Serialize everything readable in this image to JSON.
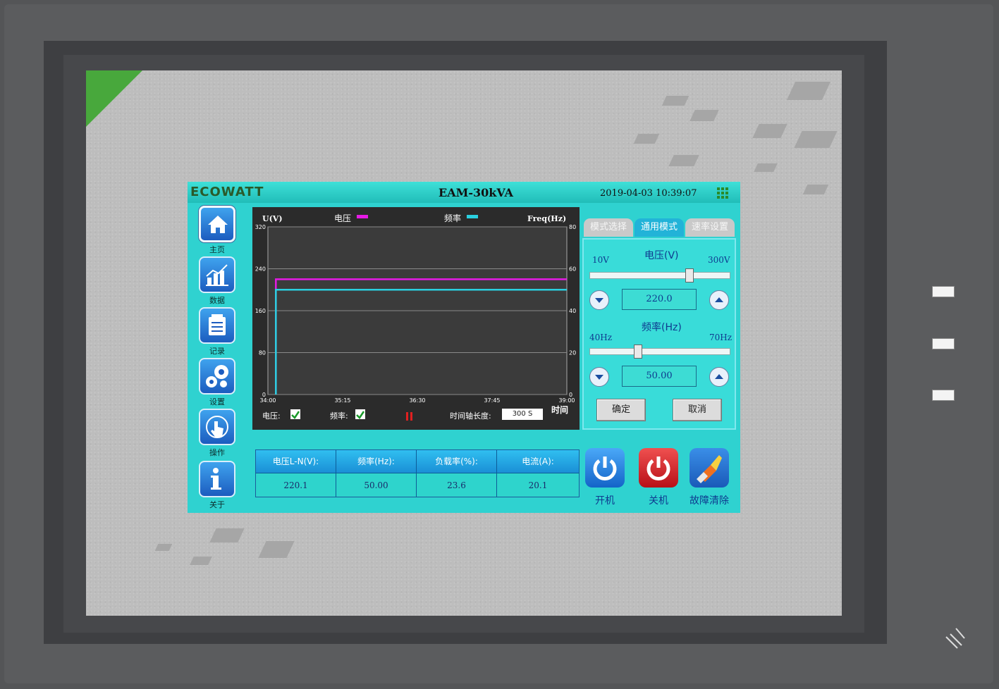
{
  "header": {
    "logo": "ECOWATT",
    "model": "EAM-30kVA",
    "datetime": "2019-04-03 10:39:07",
    "menu_icon": "grid-menu-icon"
  },
  "sidebar": {
    "items": [
      {
        "label": "主页",
        "icon": "home-icon"
      },
      {
        "label": "数据",
        "icon": "bar-chart-icon"
      },
      {
        "label": "记录",
        "icon": "clipboard-icon"
      },
      {
        "label": "设置",
        "icon": "gears-icon"
      },
      {
        "label": "操作",
        "icon": "hand-pointer-icon"
      },
      {
        "label": "关于",
        "icon": "info-icon"
      }
    ]
  },
  "chart_data": {
    "type": "line",
    "ylabel_left": "U(V)",
    "ylabel_right": "Freq(Hz)",
    "xlabel": "时间",
    "y_left_ticks": [
      "320",
      "240",
      "160",
      "80",
      "0"
    ],
    "y_right_ticks": [
      "80",
      "60",
      "40",
      "20",
      "0"
    ],
    "ylim_left": [
      0,
      320
    ],
    "ylim_right": [
      0,
      80
    ],
    "x_ticks": [
      "34:00",
      "35:15",
      "36:30",
      "37:45",
      "39:00"
    ],
    "series": [
      {
        "name": "电压",
        "color": "#e61ae6",
        "axis": "left",
        "x": [
          "34:08",
          "34:08",
          "39:00"
        ],
        "y": [
          0,
          220,
          220
        ]
      },
      {
        "name": "频率",
        "color": "#2ad0e0",
        "axis": "right",
        "x": [
          "34:08",
          "34:08",
          "39:00"
        ],
        "y": [
          0,
          50,
          50
        ]
      }
    ],
    "grid": true,
    "legend_position": "top"
  },
  "chart_controls": {
    "voltage_label": "电压:",
    "frequency_label": "频率:",
    "voltage_checked": true,
    "frequency_checked": true,
    "time_axis_label": "时间轴长度:",
    "time_axis_value": "300 S",
    "pause_icon": "pause-icon"
  },
  "tabs": [
    {
      "label": "模式选择",
      "active": false
    },
    {
      "label": "通用模式",
      "active": true
    },
    {
      "label": "速率设置",
      "active": false
    }
  ],
  "voltage_panel": {
    "title": "电压(V)",
    "min_label": "10V",
    "max_label": "300V",
    "value": "220.0",
    "slider_fraction": 0.72
  },
  "frequency_panel": {
    "title": "频率(Hz)",
    "min_label": "40Hz",
    "max_label": "70Hz",
    "value": "50.00",
    "slider_fraction": 0.33
  },
  "buttons": {
    "confirm": "确定",
    "cancel": "取消",
    "power_on": "开机",
    "power_off": "关机",
    "fault_clear": "故障清除"
  },
  "readings": {
    "headers": [
      "电压L-N(V):",
      "频率(Hz):",
      "负载率(%):",
      "电流(A):"
    ],
    "values": [
      "220.1",
      "50.00",
      "23.6",
      "20.1"
    ]
  },
  "colors": {
    "screen_bg": "#2fd2d0",
    "voltage_line": "#e61ae6",
    "frequency_line": "#2ad0e0",
    "power_on": "#1e7ee0",
    "power_off": "#d8202a"
  }
}
